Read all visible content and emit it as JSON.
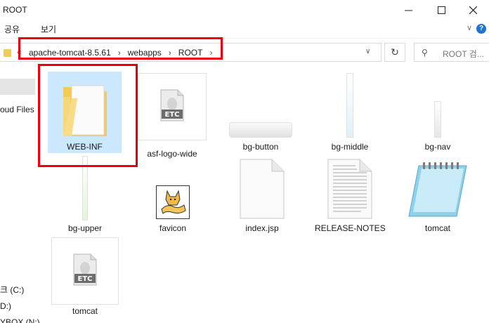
{
  "window": {
    "title": "ROOT"
  },
  "ribbon": {
    "tabs": [
      "공유",
      "보기"
    ]
  },
  "address": {
    "crumbs": [
      "apache-tomcat-8.5.61",
      "webapps",
      "ROOT"
    ],
    "overflow": "«"
  },
  "search": {
    "placeholder": "ROOT 검..."
  },
  "nav": {
    "items": [
      "oud Files",
      "크 (C:)",
      "D:)",
      "YBOX (N:)"
    ]
  },
  "files": [
    {
      "name": "WEB-INF",
      "icon": "folder-icon",
      "selected": true
    },
    {
      "name": "asf-logo-wide",
      "icon": "etc-file-icon",
      "badge": "ETC"
    },
    {
      "name": "bg-button",
      "icon": "image-thumbnail"
    },
    {
      "name": "bg-middle",
      "icon": "image-thumbnail"
    },
    {
      "name": "bg-nav",
      "icon": "image-thumbnail"
    },
    {
      "name": "bg-upper",
      "icon": "image-thumbnail"
    },
    {
      "name": "favicon",
      "icon": "tomcat-favicon"
    },
    {
      "name": "index.jsp",
      "icon": "blank-file-icon"
    },
    {
      "name": "RELEASE-NOTES",
      "icon": "text-file-icon"
    },
    {
      "name": "tomcat",
      "icon": "notepad-file-icon"
    },
    {
      "name": "tomcat",
      "icon": "etc-file-icon",
      "badge": "ETC"
    }
  ],
  "colors": {
    "highlight": "#e60012",
    "selection": "#cce8ff",
    "folder": "#f2ca57"
  }
}
